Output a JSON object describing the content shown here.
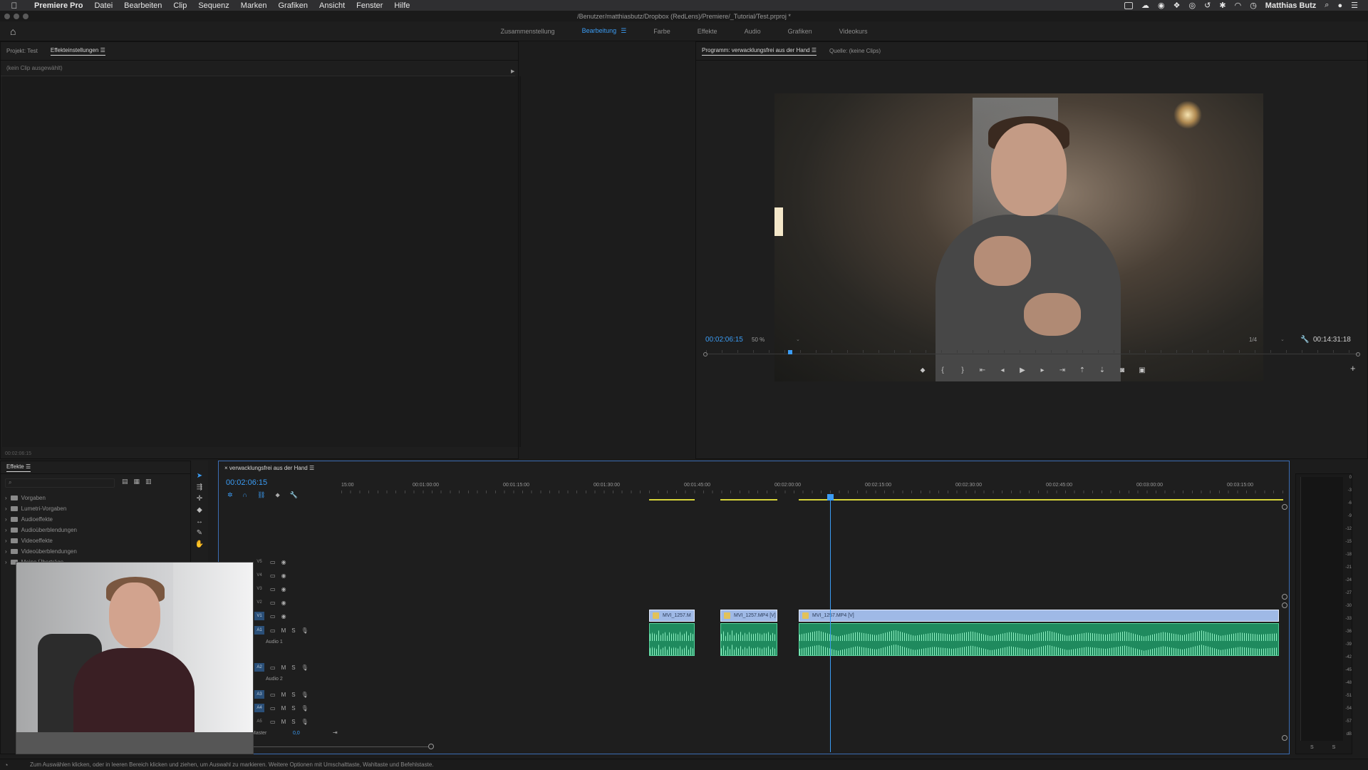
{
  "menubar": {
    "app_name": "Premiere Pro",
    "items": [
      "Datei",
      "Bearbeiten",
      "Clip",
      "Sequenz",
      "Marken",
      "Grafiken",
      "Ansicht",
      "Fenster",
      "Hilfe"
    ],
    "user": "Matthias Butz"
  },
  "window": {
    "title": "/Benutzer/matthiasbutz/Dropbox (RedLens)/Premiere/_Tutorial/Test.prproj *"
  },
  "workspaces": {
    "tabs": [
      "Zusammenstellung",
      "Bearbeitung",
      "Farbe",
      "Effekte",
      "Audio",
      "Grafiken",
      "Videokurs"
    ],
    "active": "Bearbeitung"
  },
  "effect_controls": {
    "tabs": [
      "Projekt: Test",
      "Effekteinstellungen"
    ],
    "no_clip": "(kein Clip ausgewählt)",
    "time": "00:02:06:15"
  },
  "program_monitor": {
    "tabs": [
      "Programm: verwacklungsfrei aus der Hand",
      "Quelle: (keine Clips)"
    ],
    "timecode": "00:02:06:15",
    "zoom": "50 %",
    "quality": "1/4",
    "duration": "00:14:31:18",
    "playhead_fraction": 0.125
  },
  "effects_panel": {
    "title": "Effekte",
    "items": [
      "Vorgaben",
      "Lumetri-Vorgaben",
      "Audioeffekte",
      "Audioüberblendungen",
      "Videoeffekte",
      "Videoüberblendungen",
      "Meine Überträge"
    ]
  },
  "timeline": {
    "sequence_name": "verwacklungsfrei aus der Hand",
    "timecode": "00:02:06:15",
    "ruler_labels": [
      "15:00",
      "00:01:00:00",
      "00:01:15:00",
      "00:01:30:00",
      "00:01:45:00",
      "00:02:00:00",
      "00:02:15:00",
      "00:02:30:00",
      "00:02:45:00",
      "00:03:00:00",
      "00:03:15:00"
    ],
    "video_tracks": [
      "V5",
      "V4",
      "V3",
      "V2",
      "V1"
    ],
    "audio_tracks": [
      "A1",
      "A2",
      "A3",
      "A4",
      "A5"
    ],
    "audio1_name": "Audio 1",
    "audio2_name": "Audio 2",
    "master_label": "Master",
    "master_value": "0,0",
    "clips": [
      {
        "label": "MVI_1257.M"
      },
      {
        "label": "MVI_1257.MP4 [V]"
      },
      {
        "label": "MVI_1257.MP4 [V]"
      }
    ]
  },
  "meter": {
    "scale": [
      "0",
      "-3",
      "-6",
      "-9",
      "-12",
      "-15",
      "-18",
      "-21",
      "-24",
      "-27",
      "-30",
      "-33",
      "-36",
      "-39",
      "-42",
      "-45",
      "-48",
      "-51",
      "-54",
      "-57",
      "dB"
    ],
    "solo": [
      "S",
      "S"
    ]
  },
  "status": {
    "text": "Zum Auswählen klicken, oder in leeren Bereich klicken und ziehen, um Auswahl zu markieren. Weitere Optionen mit Umschalttaste, Wahltaste und Befehlstaste."
  },
  "icons": {
    "apple": "apple-icon",
    "home": "home-icon",
    "playhead": "playhead-icon"
  },
  "colors": {
    "accent_blue": "#3b9cf4",
    "clip_video": "#9fb9e6",
    "clip_audio": "#1f8a5e",
    "workarea": "#d8d53a"
  }
}
